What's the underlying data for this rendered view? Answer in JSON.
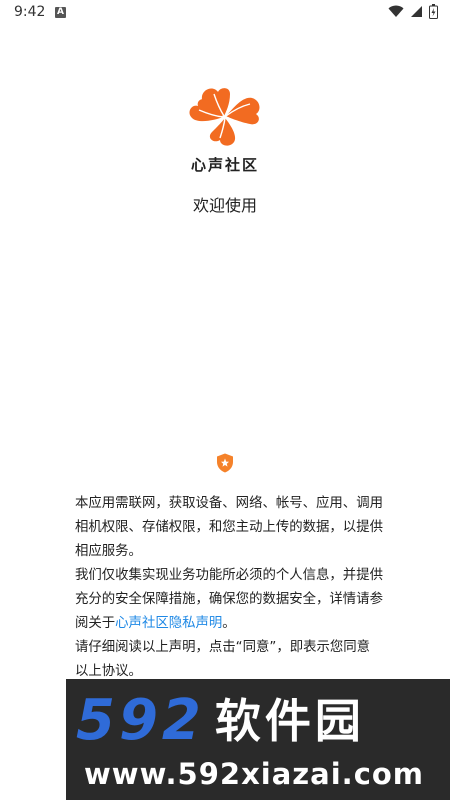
{
  "status_bar": {
    "time": "9:42",
    "notification_icon": "a-letter-icon",
    "icons": [
      "wifi-icon",
      "signal-icon",
      "battery-icon"
    ]
  },
  "brand": {
    "logo_icon": "four-petal-flower-icon",
    "logo_color": "#f26b21",
    "name": "心声社区"
  },
  "welcome": "欢迎使用",
  "notice": {
    "shield_icon": "shield-icon",
    "shield_color": "#f5822a",
    "paragraph1": "本应用需联网，获取设备、网络、帐号、应用、调用相机权限、存储权限，和您主动上传的数据，以提供相应服务。",
    "paragraph2_before": "我们仅收集实现业务功能所必须的个人信息，并提供充分的安全保障措施，确保您的数据安全，详情请参阅关于",
    "paragraph2_link": "心声社区隐私声明",
    "paragraph2_after": "。",
    "paragraph3": "请仔细阅读以上声明，点击“同意”，即表示您同意以上协议。",
    "link_color": "#1e88e5"
  },
  "watermark": {
    "digits": "592",
    "chinese": "软件园",
    "url": "www.592xiazai.com"
  }
}
